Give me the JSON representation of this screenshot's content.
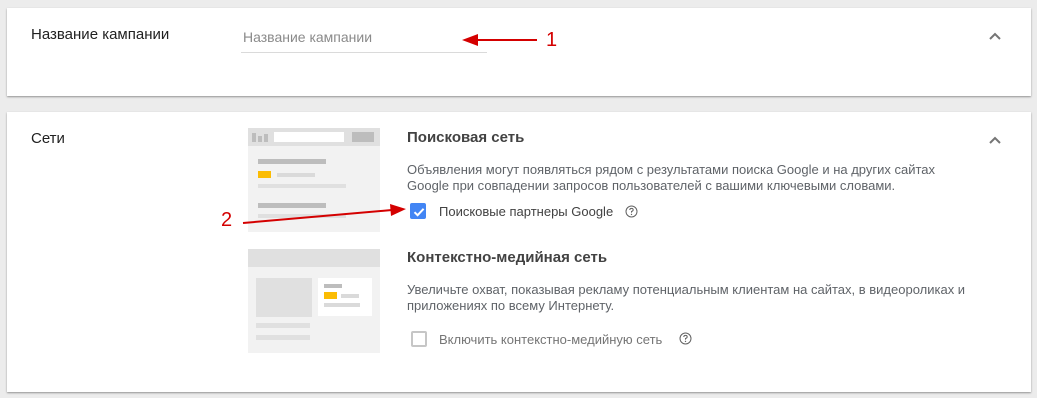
{
  "campaign_name": {
    "label": "Название кампании",
    "input_placeholder": "Название кампании",
    "input_value": ""
  },
  "networks": {
    "label": "Сети",
    "search": {
      "title": "Поисковая сеть",
      "description": "Объявления могут появляться рядом с результатами поиска Google и на других сайтах Google при совпадении запросов пользователей с вашими ключевыми словами.",
      "checkbox_label": "Поисковые партнеры Google",
      "checkbox_checked": true
    },
    "display": {
      "title": "Контекстно-медийная сеть",
      "description": "Увеличьте охват, показывая рекламу потенциальным клиентам на сайтах, в видеороликах и приложениях по всему Интернету.",
      "checkbox_label": "Включить контекстно-медийную сеть",
      "checkbox_checked": false
    }
  },
  "annotations": {
    "marker_1": "1",
    "marker_2": "2"
  },
  "colors": {
    "accent": "#4285f4",
    "highlight": "#fbbc04",
    "annotation": "#d40000",
    "card_bg": "#ffffff",
    "page_bg": "#ececec"
  },
  "icons": {
    "collapse": "chevron-up-icon",
    "help": "help-circle-icon",
    "check": "check-icon",
    "search_mock": "search-icon"
  }
}
